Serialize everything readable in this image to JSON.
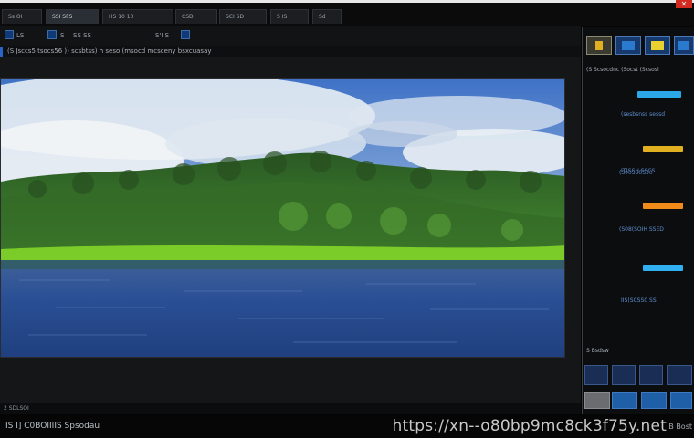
{
  "window": {
    "tabs": [
      {
        "label": "Ss OI"
      },
      {
        "label": "SSI SFS"
      },
      {
        "label": "HS 10 10"
      },
      {
        "label": "CSD"
      },
      {
        "label": "SCI SD"
      },
      {
        "label": "S IS"
      },
      {
        "label": "Sd"
      }
    ],
    "close_symbol": "✕"
  },
  "toolbar": {
    "items": [
      {
        "label": "LS"
      },
      {
        "label": "S"
      },
      {
        "label": "SS SS"
      },
      {
        "label": "S'I S"
      }
    ]
  },
  "info": {
    "text": "(S Jsccs5 tsocs56 )) scsbtss) h seso (msocd mcsceny bsxcuasay"
  },
  "status": {
    "coords": "2 SDLSOI",
    "app_name": "IS I] C0BOIIIIS Spsodau",
    "watermark": "https://xn--o80bp9mc8ck3f75y.net",
    "extra": "B Bost"
  },
  "right_panel": {
    "header": "(S Scsocdnc (Socst (Scsosl",
    "layers": [
      {
        "label": "(sesbsnss sessd",
        "color": "#2aa8e8"
      },
      {
        "label": "IT(SSH SSCS",
        "color": "#e0b020"
      },
      {
        "label": "(S08(SOIH SSED",
        "color": "#f08a18"
      },
      {
        "label": "IIS(SCSS0 SS",
        "color": "#30b0f0"
      },
      {
        "label": "(S00SS0S30",
        "color": "#2aa8e8"
      }
    ],
    "footer": "S Bsdsw"
  },
  "colors": {
    "accent": "#2b64c8",
    "sky": "#5a86c8",
    "forest": "#2f6a28",
    "water": "#2a4f94"
  }
}
